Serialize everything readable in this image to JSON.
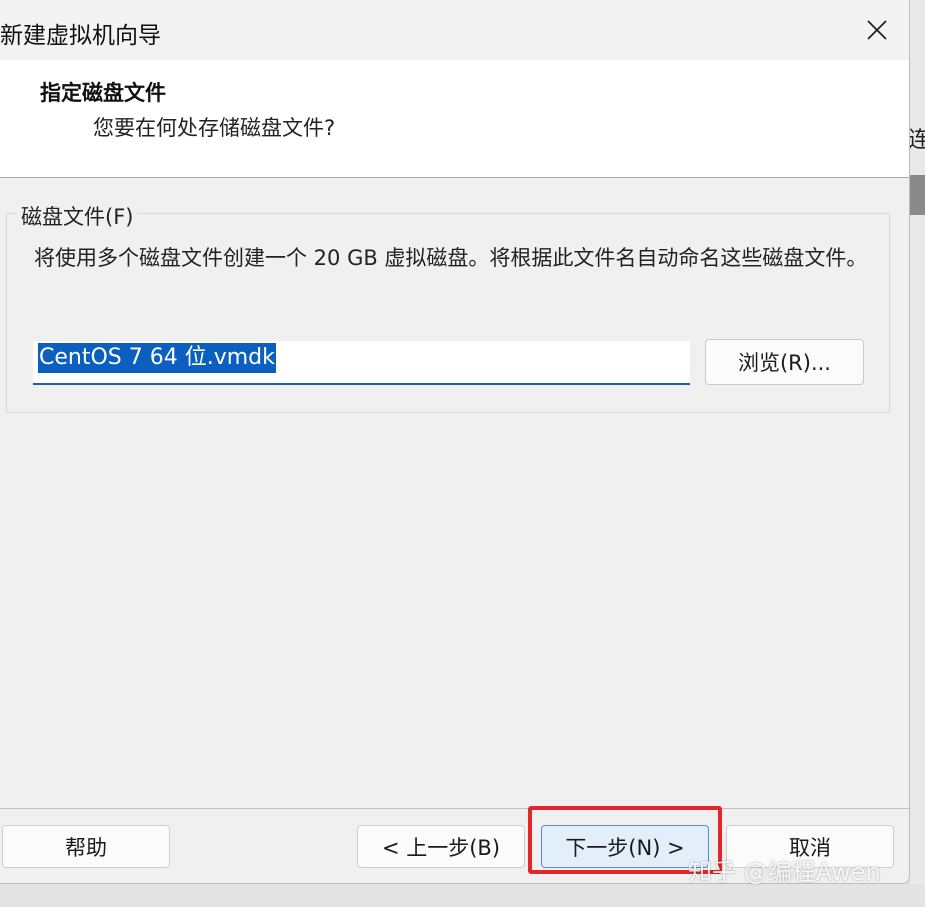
{
  "window": {
    "title": "新建虚拟机向导",
    "close_icon": "close-icon"
  },
  "header": {
    "title": "指定磁盘文件",
    "subtitle": "您要在何处存储磁盘文件?"
  },
  "disk_file_group": {
    "label": "磁盘文件(F)",
    "description": "将使用多个磁盘文件创建一个 20 GB 虚拟磁盘。将根据此文件名自动命名这些磁盘文件。",
    "filename_value": "CentOS 7 64 位.vmdk",
    "browse_label": "浏览(R)..."
  },
  "footer": {
    "help_label": "帮助",
    "back_label": "< 上一步(B)",
    "next_label": "下一步(N) >",
    "cancel_label": "取消"
  },
  "background_char": "连",
  "watermark": "知乎 @编程Awen",
  "colors": {
    "selection": "#0a5fbf",
    "highlight_box": "#e3262b",
    "next_button_border": "#4f8fd6"
  }
}
